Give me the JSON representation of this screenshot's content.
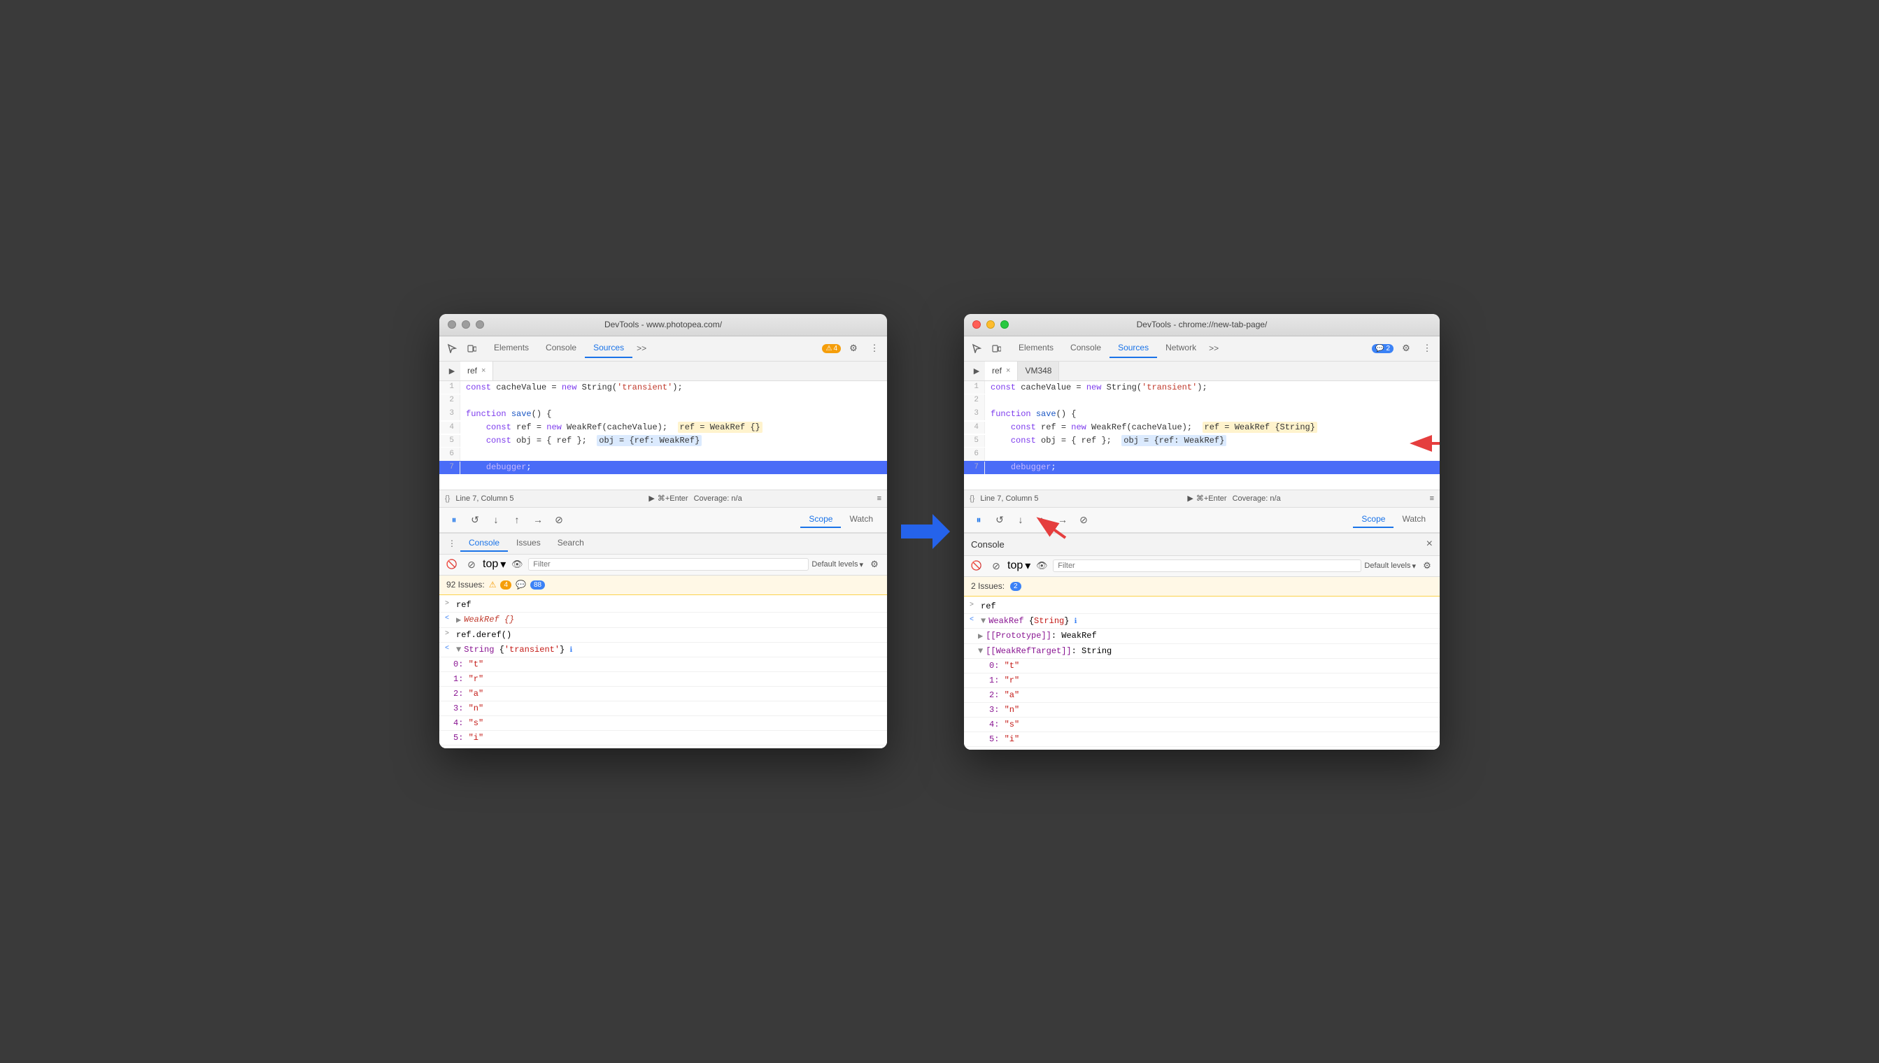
{
  "left_window": {
    "title": "DevTools - www.photopea.com/",
    "tabs": [
      "Elements",
      "Console",
      "Sources",
      ">>"
    ],
    "active_tab": "Sources",
    "badge": "4",
    "file_tabs": [
      "ref"
    ],
    "code_lines": [
      {
        "num": "1",
        "content": "const cacheValue = new String('transient');",
        "highlighted": false
      },
      {
        "num": "2",
        "content": "",
        "highlighted": false
      },
      {
        "num": "3",
        "content": "function save() {",
        "highlighted": false
      },
      {
        "num": "4",
        "content": "    const ref = new WeakRef(cacheValue);  ref = WeakRef {}",
        "highlighted": false
      },
      {
        "num": "5",
        "content": "    const obj = { ref };  obj = {ref: WeakRef}",
        "highlighted": false
      },
      {
        "num": "6",
        "content": "",
        "highlighted": false
      },
      {
        "num": "7",
        "content": "    debugger;",
        "highlighted": true
      }
    ],
    "status_bar": {
      "curly": "{}",
      "position": "Line 7, Column 5",
      "run": "⌘+Enter",
      "coverage": "Coverage: n/a"
    },
    "debug_tabs": [
      "Scope",
      "Watch"
    ],
    "active_debug_tab": "Scope",
    "bottom_tabs": [
      "Console",
      "Issues",
      "Search"
    ],
    "active_bottom_tab": "Console",
    "console_toolbar": {
      "filter_placeholder": "Filter",
      "levels": "Default levels"
    },
    "issues_text": "92 Issues:",
    "issues_warn": "4",
    "issues_msg": "88",
    "console_entries": [
      {
        "prefix": ">",
        "text": "ref"
      },
      {
        "prefix": "<",
        "text": "▶ WeakRef {}"
      },
      {
        "prefix": ">",
        "text": "ref.deref()"
      },
      {
        "prefix": "<",
        "text": "▼ String {'transient'} ℹ"
      },
      {
        "prefix": "",
        "text": "0: \"t\"",
        "indent": 1
      },
      {
        "prefix": "",
        "text": "1: \"r\"",
        "indent": 1
      },
      {
        "prefix": "",
        "text": "2: \"a\"",
        "indent": 1
      },
      {
        "prefix": "",
        "text": "3: \"n\"",
        "indent": 1
      },
      {
        "prefix": "",
        "text": "4: \"s\"",
        "indent": 1
      },
      {
        "prefix": "",
        "text": "5: \"i\"",
        "indent": 1
      }
    ],
    "top_label": "top"
  },
  "right_window": {
    "title": "DevTools - chrome://new-tab-page/",
    "tabs": [
      "Elements",
      "Console",
      "Sources",
      "Network",
      ">>"
    ],
    "active_tab": "Sources",
    "badge": "2",
    "file_tabs": [
      "ref",
      "VM348"
    ],
    "active_file_tab": "ref",
    "code_lines": [
      {
        "num": "1",
        "content": "const cacheValue = new String('transient');",
        "highlighted": false
      },
      {
        "num": "2",
        "content": "",
        "highlighted": false
      },
      {
        "num": "3",
        "content": "function save() {",
        "highlighted": false
      },
      {
        "num": "4",
        "content": "    const ref = new WeakRef(cacheValue);  ref = WeakRef {String}",
        "highlighted": false
      },
      {
        "num": "5",
        "content": "    const obj = { ref };  obj = {ref: WeakRef}",
        "highlighted": false
      },
      {
        "num": "6",
        "content": "",
        "highlighted": false
      },
      {
        "num": "7",
        "content": "    debugger;",
        "highlighted": true
      }
    ],
    "status_bar": {
      "curly": "{}",
      "position": "Line 7, Column 5",
      "run": "⌘+Enter",
      "coverage": "Coverage: n/a"
    },
    "debug_tabs": [
      "Scope",
      "Watch"
    ],
    "active_debug_tab": "Scope",
    "console_header": "Console",
    "console_toolbar": {
      "filter_placeholder": "Filter",
      "levels": "Default levels"
    },
    "issues_text": "2 Issues:",
    "issues_badge": "2",
    "console_entries": [
      {
        "prefix": ">",
        "text": "ref"
      },
      {
        "prefix": "<",
        "text": "▼ WeakRef {String} ℹ"
      },
      {
        "prefix": "",
        "text": "▶ [[Prototype]]: WeakRef",
        "indent": 1
      },
      {
        "prefix": "",
        "text": "▼ [[WeakRefTarget]]: String",
        "indent": 1
      },
      {
        "prefix": "",
        "text": "0: \"t\"",
        "indent": 2
      },
      {
        "prefix": "",
        "text": "1: \"r\"",
        "indent": 2
      },
      {
        "prefix": "",
        "text": "2: \"a\"",
        "indent": 2
      },
      {
        "prefix": "",
        "text": "3: \"n\"",
        "indent": 2
      },
      {
        "prefix": "",
        "text": "4: \"s\"",
        "indent": 2
      },
      {
        "prefix": "",
        "text": "5: \"i\"",
        "indent": 2
      }
    ],
    "top_label": "top"
  }
}
